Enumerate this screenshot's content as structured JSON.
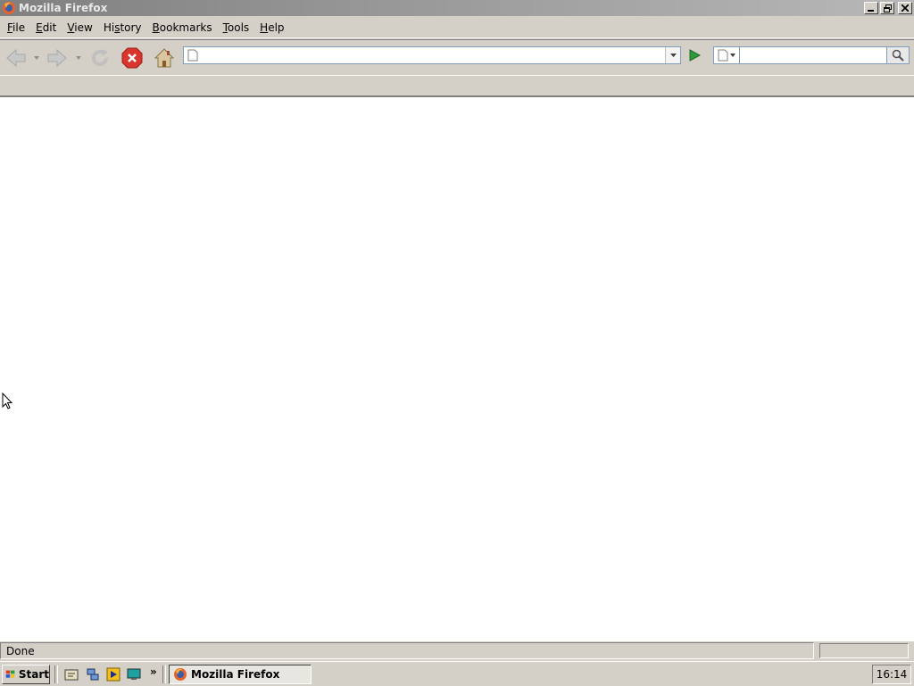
{
  "window": {
    "title": "Mozilla Firefox"
  },
  "menu": [
    {
      "pre": "",
      "u": "F",
      "post": "ile"
    },
    {
      "pre": "",
      "u": "E",
      "post": "dit"
    },
    {
      "pre": "",
      "u": "V",
      "post": "iew"
    },
    {
      "pre": "Hi",
      "u": "s",
      "post": "tory"
    },
    {
      "pre": "",
      "u": "B",
      "post": "ookmarks"
    },
    {
      "pre": "",
      "u": "T",
      "post": "ools"
    },
    {
      "pre": "",
      "u": "H",
      "post": "elp"
    }
  ],
  "toolbar": {
    "url_value": "",
    "search_value": "",
    "icons": [
      "back-icon",
      "forward-icon",
      "reload-icon",
      "stop-icon",
      "home-icon",
      "go-icon",
      "search-icon"
    ]
  },
  "status": {
    "text": "Done"
  },
  "taskbar": {
    "start_label": "Start",
    "task_label": "Mozilla Firefox",
    "clock": "16:14"
  },
  "colors": {
    "stop_red": "#d8352c",
    "go_green": "#2e9a3a",
    "chrome_gray": "#d4d0c8"
  }
}
